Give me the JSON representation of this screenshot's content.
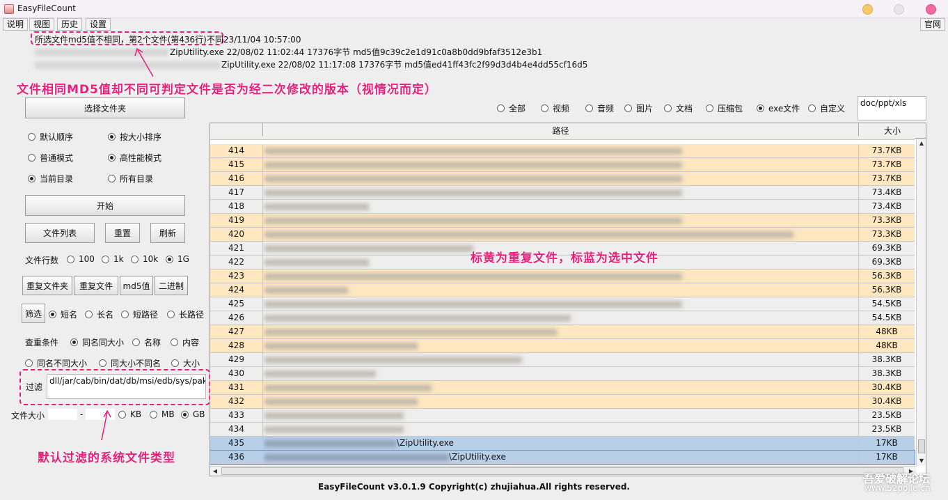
{
  "window": {
    "title": "EasyFileCount"
  },
  "menu": [
    "说明",
    "视图",
    "历史",
    "设置"
  ],
  "website_button": "官网",
  "info": {
    "line1": "所选文件md5值不相同，第2个文件(第436行)不同23/11/04 10:57:00",
    "line2": "ZipUtility.exe  22/08/02 11:02:44  17376字节  md5值9c39c2e1d91c0a8b0dd9bfaf3512e3b1",
    "line3": "ZipUtility.exe  22/08/02 11:17:08  17376字节  md5值ed41ff43fc2f99d3d4b4e4dd55cf16d5"
  },
  "annotations": {
    "md5_note": "文件相同MD5值却不同可判定文件是否为经二次修改的版本（视情况而定）",
    "highlight_note": "标黄为重复文件，标蓝为选中文件",
    "filter_note": "默认过滤的系统文件类型"
  },
  "buttons": {
    "select_folder": "选择文件夹",
    "start": "开始",
    "file_list": "文件列表",
    "reset": "重置",
    "refresh": "刷新",
    "dup_folder": "重复文件夹",
    "dup_file": "重复文件",
    "md5": "md5值",
    "binary": "二进制",
    "filter": "筛选"
  },
  "types": [
    {
      "label": "全部",
      "on": false
    },
    {
      "label": "视频",
      "on": false
    },
    {
      "label": "音频",
      "on": false
    },
    {
      "label": "图片",
      "on": false
    },
    {
      "label": "文档",
      "on": false
    },
    {
      "label": "压缩包",
      "on": false
    },
    {
      "label": "exe文件",
      "on": true
    },
    {
      "label": "自定义",
      "on": false
    }
  ],
  "custom_ext": "doc/ppt/xls",
  "sort": {
    "default": "默认顺序",
    "by_size": "按大小排序"
  },
  "mode": {
    "normal": "普通模式",
    "high": "高性能模式"
  },
  "dir": {
    "current": "当前目录",
    "all": "所有目录"
  },
  "rows_label": "文件行数",
  "row_opts": [
    "100",
    "1k",
    "10k",
    "1G"
  ],
  "name_opts": [
    "短名",
    "长名",
    "短路径",
    "长路径"
  ],
  "dup_label": "查重条件",
  "dup_opts": [
    "同名同大小",
    "名称",
    "内容"
  ],
  "dup_opts2": [
    "同名不同大小",
    "同大小不同名",
    "大小"
  ],
  "filter_label": "过滤",
  "filter_value": "dll/jar/cab/bin/dat/db/msi/edb/sys/pak/jsa",
  "size_label": "文件大小",
  "size_sep": "-",
  "size_units": [
    "KB",
    "MB",
    "GB"
  ],
  "table": {
    "headers": [
      "",
      "路径",
      "大小"
    ],
    "rows": [
      {
        "no": "414",
        "path": "",
        "size": "73.7KB",
        "t": "dup",
        "w": 600
      },
      {
        "no": "415",
        "path": "",
        "size": "73.7KB",
        "t": "dup",
        "w": 600
      },
      {
        "no": "416",
        "path": "",
        "size": "73.7KB",
        "t": "dup",
        "w": 600
      },
      {
        "no": "417",
        "path": "",
        "size": "73.4KB",
        "t": "norm",
        "w": 600
      },
      {
        "no": "418",
        "path": "",
        "size": "73.4KB",
        "t": "norm",
        "w": 150
      },
      {
        "no": "419",
        "path": "",
        "size": "73.3KB",
        "t": "dup",
        "w": 600
      },
      {
        "no": "420",
        "path": "",
        "size": "73.3KB",
        "t": "dup",
        "w": 760
      },
      {
        "no": "421",
        "path": "",
        "size": "69.3KB",
        "t": "norm",
        "w": 300
      },
      {
        "no": "422",
        "path": "",
        "size": "69.3KB",
        "t": "norm",
        "w": 150
      },
      {
        "no": "423",
        "path": "",
        "size": "56.3KB",
        "t": "dup",
        "w": 600
      },
      {
        "no": "424",
        "path": "",
        "size": "56.3KB",
        "t": "dup",
        "w": 120
      },
      {
        "no": "425",
        "path": "",
        "size": "54.5KB",
        "t": "norm",
        "w": 600
      },
      {
        "no": "426",
        "path": "",
        "size": "54.5KB",
        "t": "norm",
        "w": 440
      },
      {
        "no": "427",
        "path": "",
        "size": "48KB",
        "t": "dup",
        "w": 420
      },
      {
        "no": "428",
        "path": "",
        "size": "48KB",
        "t": "dup",
        "w": 220
      },
      {
        "no": "429",
        "path": "",
        "size": "38.3KB",
        "t": "norm",
        "w": 370
      },
      {
        "no": "430",
        "path": "",
        "size": "38.3KB",
        "t": "norm",
        "w": 160
      },
      {
        "no": "431",
        "path": "",
        "size": "30.4KB",
        "t": "dup",
        "w": 240
      },
      {
        "no": "432",
        "path": "",
        "size": "30.4KB",
        "t": "dup",
        "w": 220
      },
      {
        "no": "433",
        "path": "",
        "size": "23.5KB",
        "t": "norm",
        "w": 200
      },
      {
        "no": "434",
        "path": "",
        "size": "23.5KB",
        "t": "norm",
        "w": 200
      },
      {
        "no": "435",
        "path": "\\ZipUtility.exe",
        "size": "17KB",
        "t": "sel",
        "w": 190
      },
      {
        "no": "436",
        "path": "\\ZipUtility.exe",
        "size": "17KB",
        "t": "sel",
        "w": 265
      }
    ]
  },
  "footer": "EasyFileCount v3.0.1.9 Copyright(c) zhujiahua.All rights reserved.",
  "watermark": {
    "line1": "吾爱破解论坛",
    "line2": "www.52pojie.cn"
  },
  "colors": {
    "accent": "#e8207c",
    "dup_row": "#fde6c0",
    "sel_row": "#b8cfe8"
  }
}
